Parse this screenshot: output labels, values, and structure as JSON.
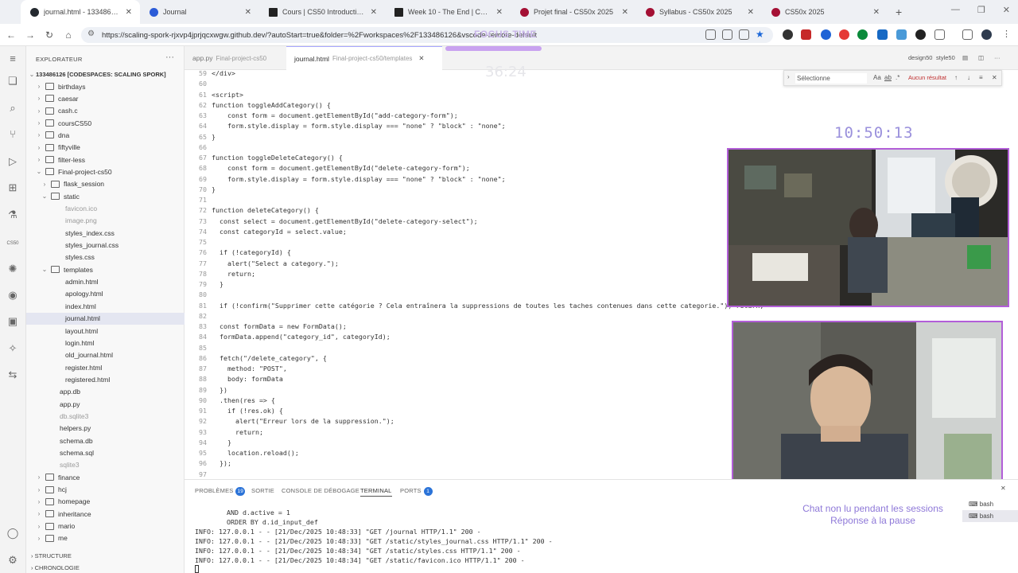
{
  "browser": {
    "tabs": [
      {
        "title": "journal.html - 133486126 [Codes",
        "active": true
      },
      {
        "title": "Journal"
      },
      {
        "title": "Cours | CS50 Introduction à l'info"
      },
      {
        "title": "Week 10 - The End | CS50x 2025"
      },
      {
        "title": "Projet final - CS50x 2025"
      },
      {
        "title": "Syllabus - CS50x 2025"
      },
      {
        "title": "CS50x 2025"
      }
    ],
    "url": "https://scaling-spork-rjxvp4jprjqcxwgw.github.dev/?autoStart=true&folder=%2Fworkspaces%2F133486126&vscode-remote-default"
  },
  "focus": {
    "title": "FOCUS TIME",
    "timer": "36:24"
  },
  "explorer": {
    "header": "EXPLORATEUR",
    "root": "133486126 [CODESPACES: SCALING SPORK]",
    "items": [
      {
        "label": "birthdays",
        "type": "folder",
        "depth": 1
      },
      {
        "label": "caesar",
        "type": "folder",
        "depth": 1
      },
      {
        "label": "cash.c",
        "type": "folder",
        "depth": 1
      },
      {
        "label": "coursCS50",
        "type": "folder",
        "depth": 1
      },
      {
        "label": "dna",
        "type": "folder",
        "depth": 1
      },
      {
        "label": "fiftyville",
        "type": "folder",
        "depth": 1
      },
      {
        "label": "filter-less",
        "type": "folder",
        "depth": 1
      },
      {
        "label": "Final-project-cs50",
        "type": "folder-open",
        "depth": 1
      },
      {
        "label": "flask_session",
        "type": "folder",
        "depth": 2
      },
      {
        "label": "static",
        "type": "folder-open",
        "depth": 2
      },
      {
        "label": "favicon.ico",
        "type": "file",
        "depth": 3,
        "muted": true
      },
      {
        "label": "image.png",
        "type": "file",
        "depth": 3,
        "muted": true
      },
      {
        "label": "styles_index.css",
        "type": "file",
        "depth": 3
      },
      {
        "label": "styles_journal.css",
        "type": "file",
        "depth": 3
      },
      {
        "label": "styles.css",
        "type": "file",
        "depth": 3
      },
      {
        "label": "templates",
        "type": "folder-open",
        "depth": 2
      },
      {
        "label": "admin.html",
        "type": "file",
        "depth": 3
      },
      {
        "label": "apology.html",
        "type": "file",
        "depth": 3
      },
      {
        "label": "index.html",
        "type": "file",
        "depth": 3
      },
      {
        "label": "journal.html",
        "type": "file",
        "depth": 3,
        "selected": true
      },
      {
        "label": "layout.html",
        "type": "file",
        "depth": 3
      },
      {
        "label": "login.html",
        "type": "file",
        "depth": 3
      },
      {
        "label": "old_journal.html",
        "type": "file",
        "depth": 3
      },
      {
        "label": "register.html",
        "type": "file",
        "depth": 3
      },
      {
        "label": "registered.html",
        "type": "file",
        "depth": 3
      },
      {
        "label": "app.db",
        "type": "file",
        "depth": 2
      },
      {
        "label": "app.py",
        "type": "file",
        "depth": 2
      },
      {
        "label": "db.sqlite3",
        "type": "file",
        "depth": 2,
        "muted": true
      },
      {
        "label": "helpers.py",
        "type": "file",
        "depth": 2
      },
      {
        "label": "schema.db",
        "type": "file",
        "depth": 2
      },
      {
        "label": "schema.sql",
        "type": "file",
        "depth": 2
      },
      {
        "label": "sqlite3",
        "type": "file",
        "depth": 2,
        "muted": true
      },
      {
        "label": "finance",
        "type": "folder",
        "depth": 1
      },
      {
        "label": "hcj",
        "type": "folder",
        "depth": 1
      },
      {
        "label": "homepage",
        "type": "folder",
        "depth": 1
      },
      {
        "label": "inheritance",
        "type": "folder",
        "depth": 1
      },
      {
        "label": "mario",
        "type": "folder",
        "depth": 1
      },
      {
        "label": "me",
        "type": "folder",
        "depth": 1
      }
    ],
    "outline": "STRUCTURE",
    "timeline": "CHRONOLOGIE"
  },
  "editor": {
    "tabs": [
      {
        "label": "app.py",
        "sub": "Final-project-cs50"
      },
      {
        "label": "journal.html",
        "sub": "Final-project-cs50/templates",
        "active": true
      }
    ],
    "right_labels": [
      "design50",
      "style50"
    ],
    "lines": [
      {
        "n": "59",
        "t": "</div>"
      },
      {
        "n": "60",
        "t": ""
      },
      {
        "n": "61",
        "t": "<script>"
      },
      {
        "n": "62",
        "t": "function toggleAddCategory() {"
      },
      {
        "n": "63",
        "t": "    const form = document.getElementById(\"add-category-form\");"
      },
      {
        "n": "64",
        "t": "    form.style.display = form.style.display === \"none\" ? \"block\" : \"none\";"
      },
      {
        "n": "65",
        "t": "}"
      },
      {
        "n": "66",
        "t": ""
      },
      {
        "n": "67",
        "t": "function toggleDeleteCategory() {"
      },
      {
        "n": "68",
        "t": "    const form = document.getElementById(\"delete-category-form\");"
      },
      {
        "n": "69",
        "t": "    form.style.display = form.style.display === \"none\" ? \"block\" : \"none\";"
      },
      {
        "n": "70",
        "t": "}"
      },
      {
        "n": "71",
        "t": ""
      },
      {
        "n": "72",
        "t": "function deleteCategory() {"
      },
      {
        "n": "73",
        "t": "  const select = document.getElementById(\"delete-category-select\");"
      },
      {
        "n": "74",
        "t": "  const categoryId = select.value;"
      },
      {
        "n": "75",
        "t": ""
      },
      {
        "n": "76",
        "t": "  if (!categoryId) {"
      },
      {
        "n": "77",
        "t": "    alert(\"Select a category.\");"
      },
      {
        "n": "78",
        "t": "    return;"
      },
      {
        "n": "79",
        "t": "  }"
      },
      {
        "n": "80",
        "t": ""
      },
      {
        "n": "81",
        "t": "  if (!confirm(\"Supprimer cette catégorie ? Cela entraînera la suppressions de toutes les taches contenues dans cette categorie.\")) return;"
      },
      {
        "n": "82",
        "t": ""
      },
      {
        "n": "83",
        "t": "  const formData = new FormData();"
      },
      {
        "n": "84",
        "t": "  formData.append(\"category_id\", categoryId);"
      },
      {
        "n": "85",
        "t": ""
      },
      {
        "n": "86",
        "t": "  fetch(\"/delete_category\", {"
      },
      {
        "n": "87",
        "t": "    method: \"POST\","
      },
      {
        "n": "88",
        "t": "    body: formData"
      },
      {
        "n": "89",
        "t": "  })"
      },
      {
        "n": "90",
        "t": "  .then(res => {"
      },
      {
        "n": "91",
        "t": "    if (!res.ok) {"
      },
      {
        "n": "92",
        "t": "      alert(\"Erreur lors de la suppression.\");"
      },
      {
        "n": "93",
        "t": "      return;"
      },
      {
        "n": "94",
        "t": "    }"
      },
      {
        "n": "95",
        "t": "    location.reload();"
      },
      {
        "n": "96",
        "t": "  });"
      },
      {
        "n": "97",
        "t": ""
      }
    ]
  },
  "find": {
    "value": "Sélectionne",
    "options": [
      "Aa",
      "ab",
      ".*"
    ],
    "result": "Aucun résultat"
  },
  "clock": "10:50:13",
  "panel": {
    "tabs": [
      {
        "label": "PROBLÈMES",
        "badge": "19"
      },
      {
        "label": "SORTIE"
      },
      {
        "label": "CONSOLE DE DÉBOGAGE"
      },
      {
        "label": "TERMINAL",
        "active": true
      },
      {
        "label": "PORTS",
        "badge": "1"
      }
    ],
    "terminal_lines": [
      "        AND d.active = 1",
      "        ORDER BY d.id_input_def",
      "INFO: 127.0.0.1 - - [21/Dec/2025 10:48:33] \"GET /journal HTTP/1.1\" 200 -",
      "INFO: 127.0.0.1 - - [21/Dec/2025 10:48:33] \"GET /static/styles_journal.css HTTP/1.1\" 200 -",
      "INFO: 127.0.0.1 - - [21/Dec/2025 10:48:34] \"GET /static/styles.css HTTP/1.1\" 200 -",
      "INFO: 127.0.0.1 - - [21/Dec/2025 10:48:34] \"GET /static/favicon.ico HTTP/1.1\" 200 -"
    ],
    "terminals": [
      "bash",
      "bash"
    ]
  },
  "chat_note": {
    "line1": "Chat non lu pendant les sessions",
    "line2": "Réponse à la pause"
  },
  "colors": {
    "accent": "#b25ed8",
    "clock": "#9a90dc",
    "chat": "#8e78d8"
  }
}
